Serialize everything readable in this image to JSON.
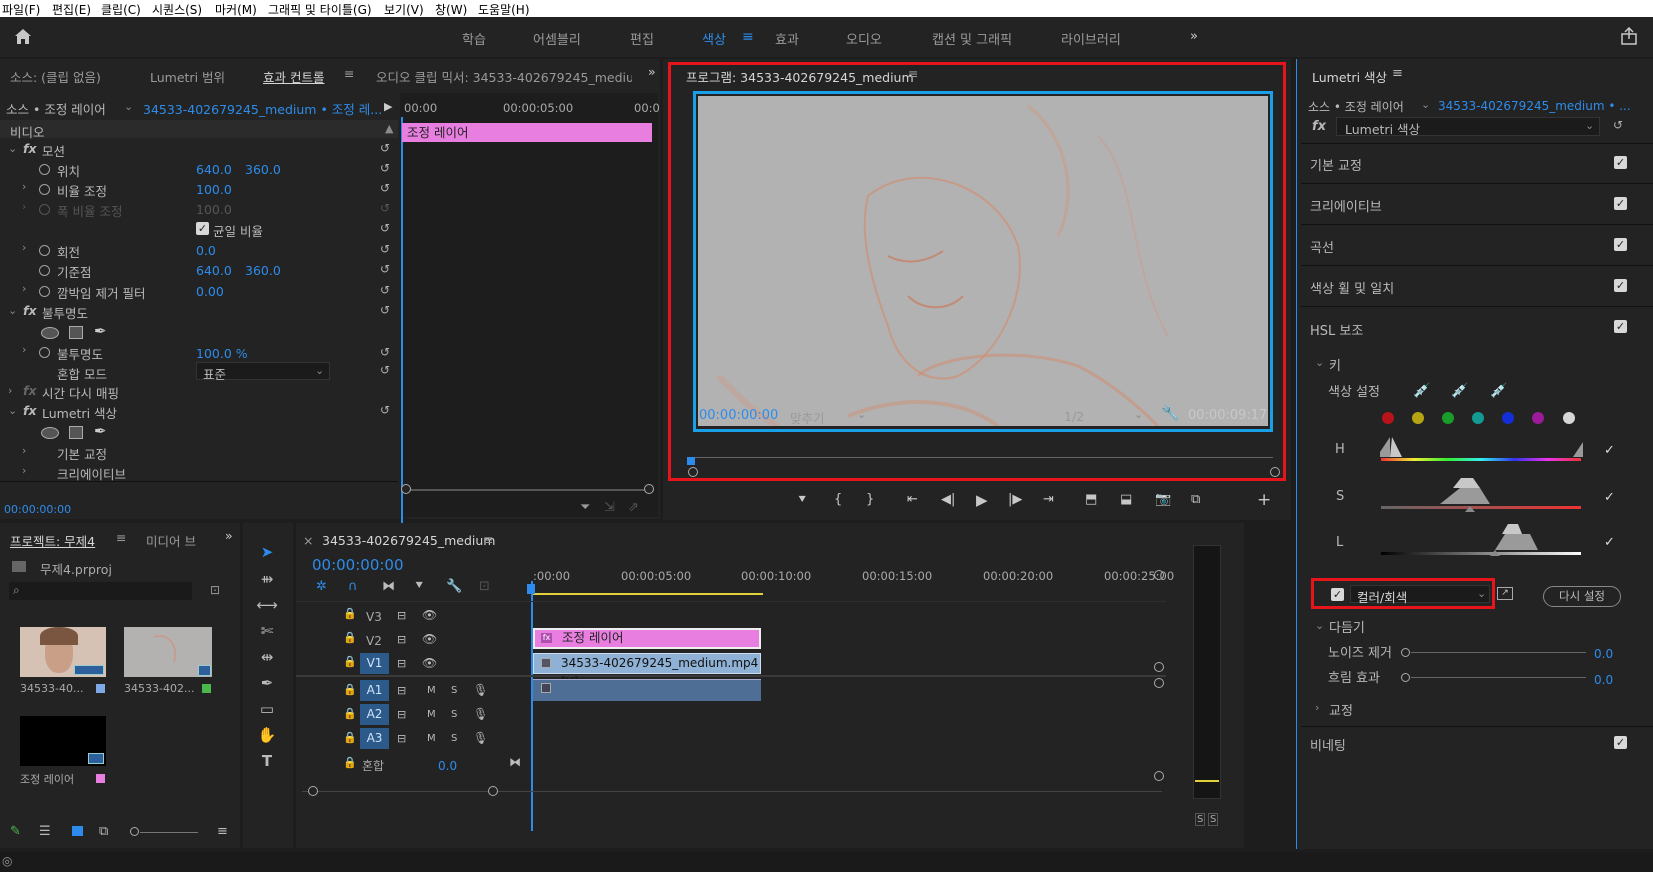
{
  "menu": [
    "파일(F)",
    "편집(E)",
    "클립(C)",
    "시퀀스(S)",
    "마커(M)",
    "그래픽 및 타이틀(G)",
    "보기(V)",
    "창(W)",
    "도움말(H)"
  ],
  "workspaces": [
    "학습",
    "어셈블리",
    "편집",
    "색상",
    "효과",
    "오디오",
    "캡션 및 그래픽",
    "라이브러리"
  ],
  "active_workspace": "색상",
  "source_panel": {
    "tabs": [
      "소스: (클립 없음)",
      "Lumetri 범위",
      "효과 컨트롤",
      "오디오 클립 믹서: 34533-402679245_medium"
    ],
    "source_line": "소스 • 조정 레이어",
    "clip_line": "34533-402679245_medium • 조정 레...",
    "ruler": [
      "00:00",
      "00:00:05:00",
      "00:0"
    ],
    "clip_name": "조정 레이어",
    "video_header": "비디오",
    "motion": "모션",
    "position": "위치",
    "position_x": "640.0",
    "position_y": "360.0",
    "scale": "비율 조정",
    "scale_value": "100.0",
    "scale_width": "폭 비율 조정",
    "scale_width_value": "100.0",
    "uniform_scale": "균일 비율",
    "rotation": "회전",
    "rotation_value": "0.0",
    "anchor": "기준점",
    "anchor_x": "640.0",
    "anchor_y": "360.0",
    "antiflicker": "깜박임 제거 필터",
    "antiflicker_value": "0.00",
    "opacity_group": "불투명도",
    "opacity": "불투명도",
    "opacity_value": "100.0 %",
    "blend_mode": "혼합 모드",
    "blend_value": "표준",
    "time_remap": "시간 다시 매핑",
    "lumetri": "Lumetri 색상",
    "basic": "기본 교정",
    "creative": "크리에이티브",
    "timecode": "00:00:00:00"
  },
  "program": {
    "title": "프로그램: 34533-402679245_medium",
    "timecode": "00:00:00:00",
    "fit": "맞추기",
    "resolution": "1/2",
    "duration": "00:00:09:17"
  },
  "project": {
    "tabs": [
      "프로젝트: 무제4",
      "미디어 브"
    ],
    "file": "무제4.prproj",
    "items": [
      "34533-40...",
      "34533-402...",
      "조정 레이어"
    ]
  },
  "timeline": {
    "title": "34533-402679245_medium",
    "timecode": "00:00:00:00",
    "ruler": [
      ":00:00",
      "00:00:05:00",
      "00:00:10:00",
      "00:00:15:00",
      "00:00:20:00",
      "00:00:25:00"
    ],
    "tracks": [
      "V3",
      "V2",
      "V1",
      "A1",
      "A2",
      "A3"
    ],
    "mix": "혼합",
    "mix_value": "0.0",
    "clip_adjust": "조정 레이어",
    "clip_video": "34533-402679245_medium.mp4 [V]"
  },
  "lumetri_panel": {
    "title": "Lumetri 색상",
    "source_line": "소스 • 조정 레이어",
    "clip_line": "34533-402679245_medium • ...",
    "fx_name": "Lumetri 색상",
    "sections": [
      "기본 교정",
      "크리에이티브",
      "곡선",
      "색상 휠 및 일치",
      "HSL 보조"
    ],
    "key": "키",
    "set_color": "색상 설정",
    "h": "H",
    "s": "S",
    "l": "L",
    "mode": "컬러/회색",
    "reset": "다시 설정",
    "refine": "다듬기",
    "denoise": "노이즈 제거",
    "denoise_value": "0.0",
    "blur": "흐림 효과",
    "blur_value": "0.0",
    "correction": "교정",
    "vignette": "비네팅"
  },
  "colors": {
    "accent": "#2d8ceb",
    "highlight_red": "#e8141b",
    "pink_clip": "#e87fe0",
    "blue_clip": "#8fb1d6"
  },
  "swatches": [
    "#b8131b",
    "#b5a513",
    "#1a9c2a",
    "#129a93",
    "#1330d8",
    "#9b1b9b",
    "#d6d6d6"
  ],
  "meter": [
    "S",
    "S"
  ]
}
